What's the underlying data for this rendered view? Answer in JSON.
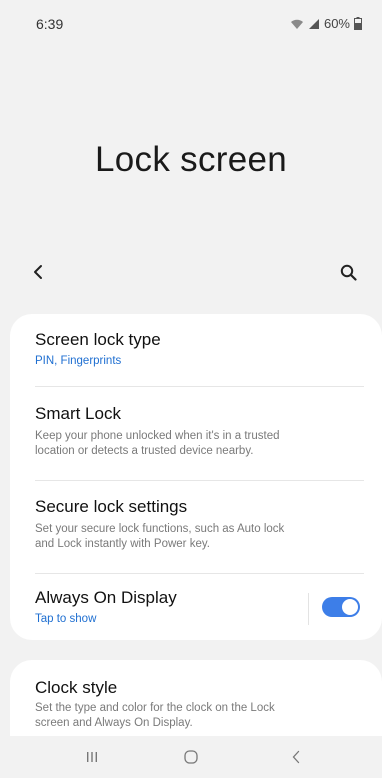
{
  "status_bar": {
    "time": "6:39",
    "battery": "60%",
    "icons": [
      "wifi-icon",
      "signal-icon",
      "battery-icon"
    ]
  },
  "header": {
    "title": "Lock screen"
  },
  "action_bar": {
    "back_icon": "back-arrow-icon",
    "search_icon": "search-icon"
  },
  "settings": {
    "screen_lock_type": {
      "title": "Screen lock type",
      "subtitle": "PIN, Fingerprints"
    },
    "smart_lock": {
      "title": "Smart Lock",
      "subtitle_line1": "Keep your phone unlocked when it's in a trusted",
      "subtitle_line2": "location or detects a trusted device nearby."
    },
    "secure_lock_settings": {
      "title": "Secure lock settings",
      "subtitle_line1": "Set your secure lock functions, such as Auto lock",
      "subtitle_line2": "and Lock instantly with Power key."
    },
    "always_on_display": {
      "title": "Always On Display",
      "subtitle": "Tap to show",
      "enabled": true
    },
    "clock_style": {
      "title": "Clock style",
      "subtitle_line1": "Set the type and color for the clock on the Lock",
      "subtitle_line2": "screen and Always On Display."
    }
  },
  "colors": {
    "accent": "#3d7ee8",
    "link_blue": "#1f6fd1",
    "background": "#f2f2f2",
    "card": "#ffffff"
  },
  "nav_bar": {
    "icons": [
      "recent-apps-icon",
      "home-icon",
      "back-nav-icon"
    ]
  }
}
